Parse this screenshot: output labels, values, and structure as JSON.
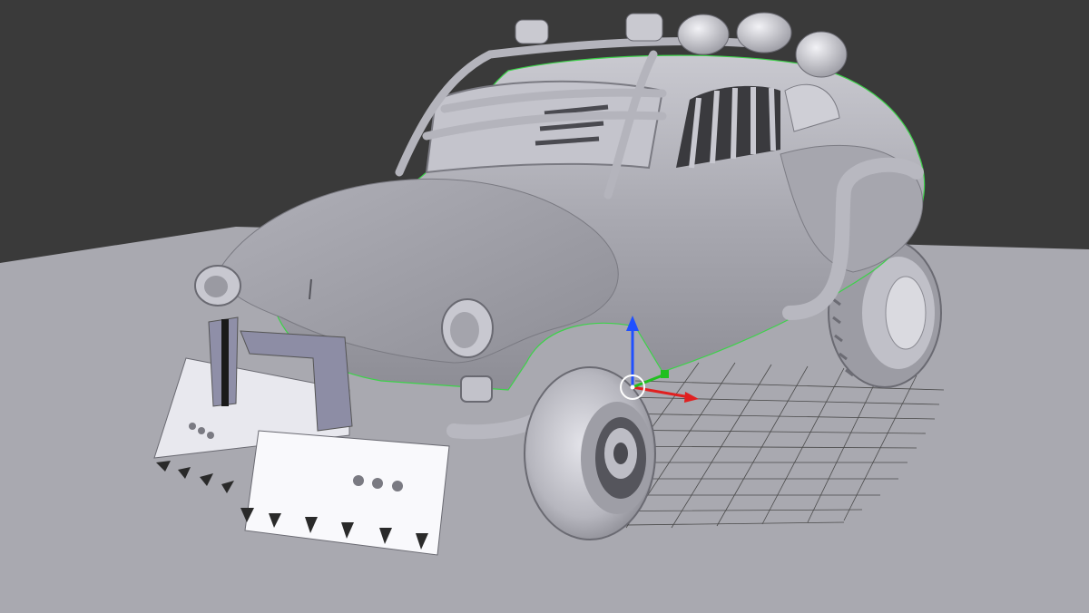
{
  "viewport": {
    "shading": "solid",
    "background_color": "#3a3a3a",
    "ground_color": "#a9a9b0",
    "grid": true,
    "grid_color": "#4a4a4a"
  },
  "model": {
    "type": "custom off-road vintage sedan",
    "material_color": "#b9b9c1",
    "selected": true,
    "selection_outline_color": "#3dd24a",
    "parts": [
      "body",
      "roll-cage",
      "roof-lights",
      "window-bars",
      "front-plow",
      "exhaust-pipes",
      "wheels"
    ]
  },
  "gizmo": {
    "type": "translate",
    "axes": [
      {
        "name": "x",
        "color": "#e02020"
      },
      {
        "name": "y",
        "color": "#20c020"
      },
      {
        "name": "z",
        "color": "#2050ff"
      }
    ],
    "origin_color": "#ffffff"
  }
}
